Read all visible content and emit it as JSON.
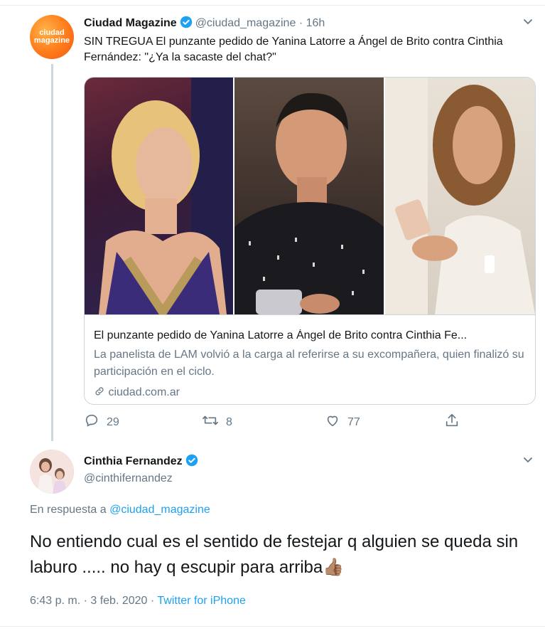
{
  "tweet1": {
    "avatar_text_line1": "ciudad",
    "avatar_text_line2": "magazine",
    "name": "Ciudad Magazine",
    "handle": "@ciudad_magazine",
    "time": "· 16h",
    "text": "SIN TREGUA El punzante pedido de Yanina Latorre a Ángel de Brito contra Cinthia Fernández: \"¿Ya la sacaste del chat?\"",
    "card": {
      "title": "El punzante pedido de Yanina Latorre a Ángel de Brito contra Cinthia Fe...",
      "description": "La panelista de LAM volvió a la carga al referirse a su excompañera, quien finalizó su participación en el ciclo.",
      "domain": "ciudad.com.ar"
    },
    "actions": {
      "replies": "29",
      "retweets": "8",
      "likes": "77"
    }
  },
  "tweet2": {
    "name": "Cinthia Fernandez",
    "handle": "@cinthifernandez",
    "reply_prefix": "En respuesta a",
    "reply_to": "@ciudad_magazine",
    "text": "No entiendo cual es el sentido de festejar q alguien se queda sin laburo ..... no hay q escupir para arriba",
    "emoji": "👍🏽",
    "timestamp": "6:43 p. m. · 3 feb. 2020",
    "separator": " · ",
    "source": "Twitter for iPhone"
  },
  "colors": {
    "accent": "#1da1f2",
    "secondary_text": "#657786",
    "border": "#ccd6dd"
  }
}
